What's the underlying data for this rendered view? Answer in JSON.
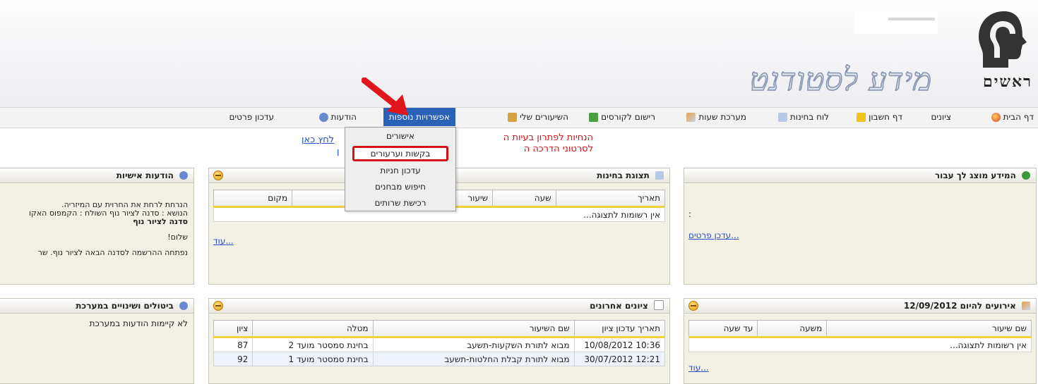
{
  "header": {
    "logo_text": "ראשים",
    "brand": "מידע לסטודנט"
  },
  "nav": {
    "items": [
      "דף הבית",
      "ציונים",
      "דף חשבון",
      "לוח בחינות",
      "מערכת שעות",
      "רישום לקורסים",
      "השיעורים שלי",
      "אפשרויות נוספות",
      "הודעות",
      "עדכון פרטים"
    ],
    "active": "אפשרויות נוספות"
  },
  "dropdown": {
    "items": [
      "אישורים",
      "בקשות וערעורים",
      "עדכון חניות",
      "חיפוש מבחנים",
      "רכישת שרותים"
    ],
    "highlighted": "בקשות וערעורים"
  },
  "announce": {
    "line1": "הנחיות לפתרון בעיות ה",
    "line2": "לסרטוני הדרכה ה",
    "link1": "לחץ כאן",
    "link2": "ן"
  },
  "panels": {
    "info": {
      "title": "המידע מוצג לך עבור",
      "update_link": "עדכן פרטים...",
      "colon": ":"
    },
    "exams": {
      "title": "תצוגת בחינות",
      "columns": [
        "תאריך",
        "שעה",
        "שיעור",
        "מקום"
      ],
      "empty": "אין רשומות לתצוגה...",
      "more": "עוד..."
    },
    "personal": {
      "title": "הודעות אישיות",
      "line1": "הנרחת לרחת את החרוית עם המיזריה.",
      "line2": "הנושא : סדנה לציור נוף השולח : הקמפוס האקו",
      "line3": "סדנה לציור נוף",
      "line4": "שלום!",
      "line5": "נפתחה ההרשמה לסדנה הבאה לציור נוף. שר"
    },
    "events": {
      "title": "אירועים להיום 12/09/2012",
      "columns": [
        "שם שיעור",
        "משעה",
        "עד שעה"
      ],
      "empty": "אין רשומות לתצוגה...",
      "more": "עוד..."
    },
    "grades": {
      "title": "ציונים אחרונים",
      "columns": [
        "תאריך עדכון ציון",
        "שם השיעור",
        "מטלה",
        "ציון"
      ],
      "rows": [
        [
          "10:36 10/08/2012",
          "מבוא לתורת השקעות-תשעב",
          "בחינת סמסטר מועד 2",
          "87"
        ],
        [
          "12:21 30/07/2012",
          "מבוא לתורת קבלת החלטות-תשעב",
          "בחינת סמסטר מועד 1",
          "92"
        ]
      ]
    },
    "cancellations": {
      "title": "ביטולים ושינויים במערכת",
      "text": "לא קיימות הודעות במערכת"
    }
  }
}
